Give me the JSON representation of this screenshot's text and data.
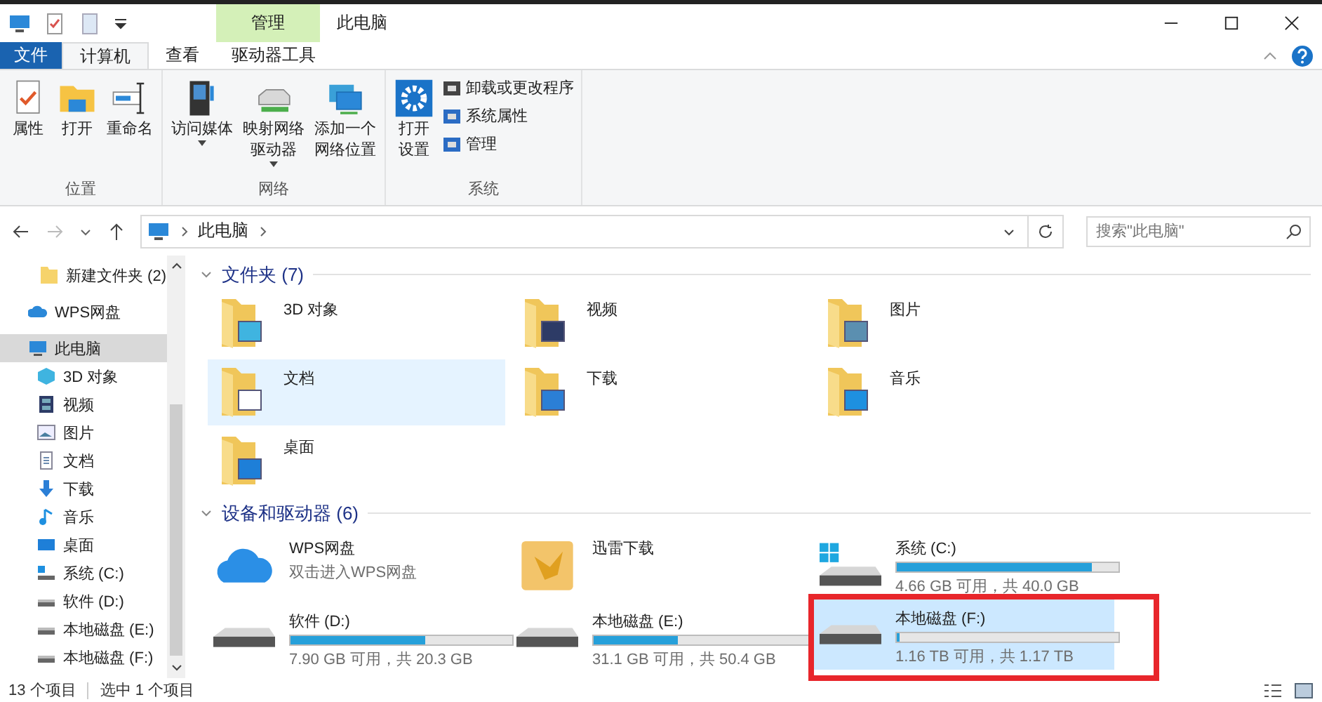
{
  "window": {
    "title": "此电脑"
  },
  "ribbon": {
    "context_tab": {
      "group": "管理",
      "label": "驱动器工具"
    },
    "tabs": [
      {
        "label": "文件",
        "selected": false,
        "kind": "file"
      },
      {
        "label": "计算机",
        "selected": true,
        "kind": "tab"
      },
      {
        "label": "查看",
        "selected": false,
        "kind": "tab"
      }
    ],
    "groups": [
      {
        "label": "位置",
        "items": [
          {
            "kind": "large",
            "lines": [
              "属性"
            ],
            "dropdown": false
          },
          {
            "kind": "large",
            "lines": [
              "打开"
            ],
            "dropdown": false
          },
          {
            "kind": "large",
            "lines": [
              "重命名"
            ],
            "dropdown": false
          }
        ]
      },
      {
        "label": "网络",
        "items": [
          {
            "kind": "large",
            "lines": [
              "访问媒体"
            ],
            "dropdown": true
          },
          {
            "kind": "large",
            "lines": [
              "映射网络",
              "驱动器"
            ],
            "dropdown": true
          },
          {
            "kind": "large",
            "lines": [
              "添加一个",
              "网络位置"
            ],
            "dropdown": false
          }
        ]
      },
      {
        "label": "系统",
        "items": [
          {
            "kind": "large",
            "lines": [
              "打开",
              "设置"
            ],
            "dropdown": false
          },
          {
            "kind": "small",
            "lines": [
              "卸载或更改程序"
            ]
          },
          {
            "kind": "small",
            "lines": [
              "系统属性"
            ]
          },
          {
            "kind": "small",
            "lines": [
              "管理"
            ]
          }
        ]
      }
    ]
  },
  "address": {
    "path": [
      "此电脑"
    ],
    "search_placeholder": "搜索\"此电脑\""
  },
  "sidebar": {
    "items": [
      {
        "label": "新建文件夹 (2)",
        "selected": false
      },
      {
        "label": "WPS网盘",
        "selected": false
      },
      {
        "label": "此电脑",
        "selected": true,
        "children": [
          {
            "label": "3D 对象",
            "selected": false
          },
          {
            "label": "视频",
            "selected": false
          },
          {
            "label": "图片",
            "selected": false
          },
          {
            "label": "文档",
            "selected": false
          },
          {
            "label": "下载",
            "selected": false
          },
          {
            "label": "音乐",
            "selected": false
          },
          {
            "label": "桌面",
            "selected": false
          },
          {
            "label": "系统 (C:)",
            "selected": false
          },
          {
            "label": "软件 (D:)",
            "selected": false
          },
          {
            "label": "本地磁盘 (E:)",
            "selected": false
          },
          {
            "label": "本地磁盘 (F:)",
            "selected": false
          }
        ]
      }
    ]
  },
  "sections": [
    {
      "title": "文件夹 (7)",
      "expanded": true,
      "items": [
        {
          "kind": "folder",
          "label": "3D 对象",
          "selected": false
        },
        {
          "kind": "folder",
          "label": "视频",
          "selected": false
        },
        {
          "kind": "folder",
          "label": "图片",
          "selected": false
        },
        {
          "kind": "folder",
          "label": "文档",
          "selected": true
        },
        {
          "kind": "folder",
          "label": "下载",
          "selected": false
        },
        {
          "kind": "folder",
          "label": "音乐",
          "selected": false
        },
        {
          "kind": "folder",
          "label": "桌面",
          "selected": false
        }
      ]
    },
    {
      "title": "设备和驱动器 (6)",
      "expanded": true,
      "items": [
        {
          "kind": "cloud",
          "label": "WPS网盘",
          "subtitle": "双击进入WPS网盘",
          "selected": false
        },
        {
          "kind": "app",
          "label": "迅雷下载",
          "selected": false
        },
        {
          "kind": "system-drive",
          "label": "系统 (C:)",
          "level": 0.88,
          "reading": "4.66 GB 可用，共 40.0 GB",
          "selected": false,
          "highlighted": false
        },
        {
          "kind": "drive",
          "label": "软件 (D:)",
          "level": 0.61,
          "reading": "7.90 GB 可用，共 20.3 GB",
          "selected": false,
          "highlighted": false
        },
        {
          "kind": "drive",
          "label": "本地磁盘 (E:)",
          "level": 0.38,
          "reading": "31.1 GB 可用，共 50.4 GB",
          "selected": false,
          "highlighted": false
        },
        {
          "kind": "drive",
          "label": "本地磁盘 (F:)",
          "level": 0.01,
          "reading": "1.16 TB 可用，共 1.17 TB",
          "selected": true,
          "highlighted": true
        }
      ]
    }
  ],
  "status_bar": {
    "count": "13 个项目",
    "selection": "选中 1 个项目"
  }
}
